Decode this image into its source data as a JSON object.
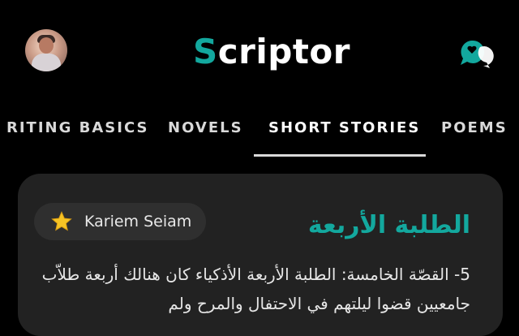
{
  "header": {
    "app_title_initial": "S",
    "app_title_rest": "criptor",
    "brand_color": "#13a89e"
  },
  "tabs": [
    {
      "label": "RITING BASICS",
      "active": false
    },
    {
      "label": "NOVELS",
      "active": false
    },
    {
      "label": "SHORT STORIES",
      "active": true
    },
    {
      "label": "POEMS",
      "active": false
    }
  ],
  "story_card": {
    "author": "Kariem Seiam",
    "title": "الطلبة الأربعة",
    "excerpt": "5- القصّة الخامسة: الطلبة الأربعة الأذكياء كان هنالك أربعة طلاّب جامعيين قضوا ليلتهم في الاحتفال والمرح ولم"
  },
  "icons": {
    "avatar": "profile-avatar",
    "chat": "chat-bubbles-icon",
    "star": "star-icon"
  }
}
